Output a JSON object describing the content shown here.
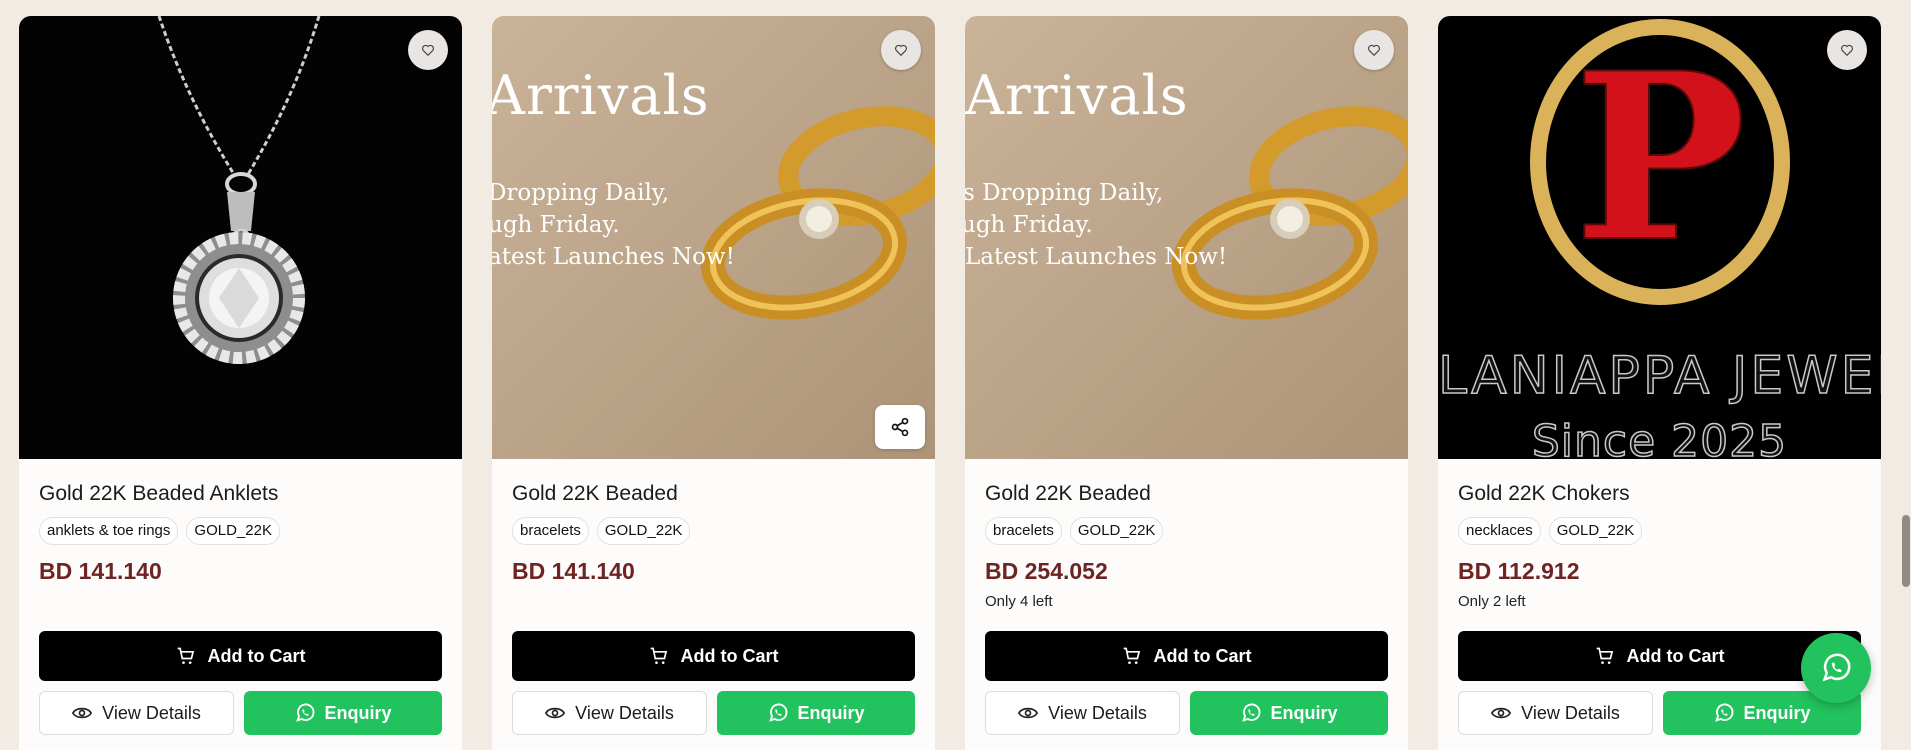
{
  "products": [
    {
      "title": "Gold 22K Beaded Anklets",
      "tags": [
        "anklets & toe rings",
        "GOLD_22K"
      ],
      "price": "BD 141.140",
      "stock": "",
      "image": "pendant-necklace"
    },
    {
      "title": "Gold 22K Beaded",
      "tags": [
        "bracelets",
        "GOLD_22K"
      ],
      "price": "BD 141.140",
      "stock": "",
      "image": "arrivals-banner-rings",
      "banner": {
        "title": "Arrivals",
        "lines": [
          "Dropping Daily,",
          "ugh Friday.",
          "atest Launches Now!"
        ]
      }
    },
    {
      "title": "Gold 22K Beaded",
      "tags": [
        "bracelets",
        "GOLD_22K"
      ],
      "price": "BD 254.052",
      "stock": "Only 4 left",
      "image": "arrivals-banner-rings",
      "banner": {
        "title": "Arrivals",
        "lines": [
          "s Dropping Daily,",
          "ugh Friday.",
          "Latest Launches Now!"
        ]
      }
    },
    {
      "title": "Gold 22K Chokers",
      "tags": [
        "necklaces",
        "GOLD_22K"
      ],
      "price": "BD 112.912",
      "stock": "Only 2 left",
      "image": "brand-logo",
      "logo": {
        "letter": "P",
        "name": "LANIAPPA JEWELLE",
        "since": "Since 2025"
      }
    }
  ],
  "buttons": {
    "add_to_cart": "Add to Cart",
    "view_details": "View Details",
    "enquiry": "Enquiry"
  },
  "icons": {
    "favorite": "heart-icon",
    "share": "share-icon",
    "cart": "cart-icon",
    "view": "eye-icon",
    "whatsapp": "whatsapp-icon"
  },
  "colors": {
    "price": "#6e2423",
    "enquiry": "#22c35e",
    "cart_button": "#000000"
  }
}
